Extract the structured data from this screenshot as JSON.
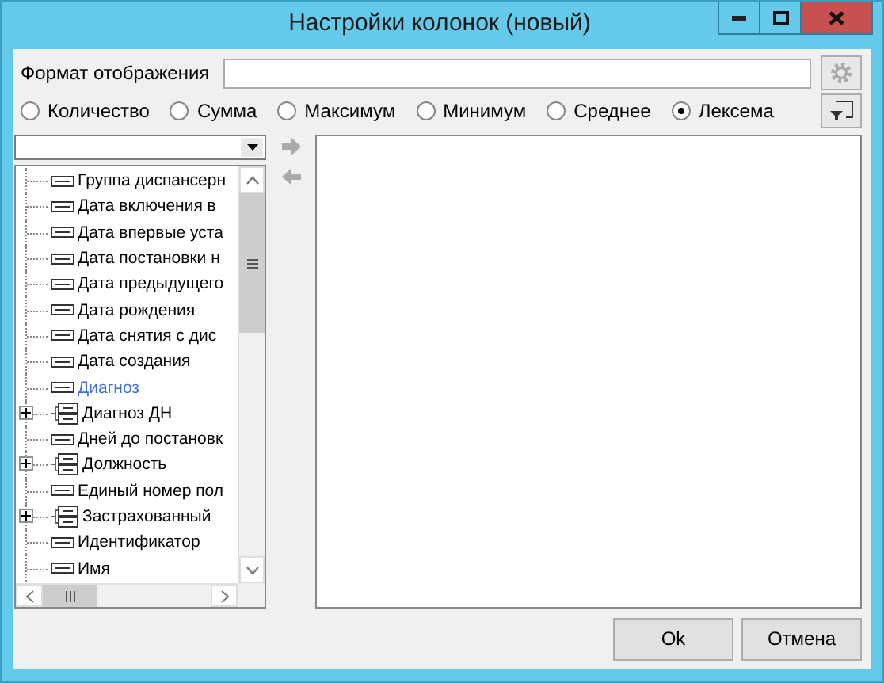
{
  "window": {
    "title": "Настройки колонок (новый)"
  },
  "format": {
    "label": "Формат отображения"
  },
  "aggregates": [
    {
      "label": "Количество",
      "selected": false
    },
    {
      "label": "Сумма",
      "selected": false
    },
    {
      "label": "Максимум",
      "selected": false
    },
    {
      "label": "Минимум",
      "selected": false
    },
    {
      "label": "Среднее",
      "selected": false
    },
    {
      "label": "Лексема",
      "selected": true
    }
  ],
  "fields": [
    {
      "label": "Группа диспансерн",
      "kind": "leaf",
      "selected": false
    },
    {
      "label": "Дата включения в",
      "kind": "leaf",
      "selected": false
    },
    {
      "label": "Дата впервые уста",
      "kind": "leaf",
      "selected": false
    },
    {
      "label": "Дата постановки н",
      "kind": "leaf",
      "selected": false
    },
    {
      "label": "Дата предыдущего",
      "kind": "leaf",
      "selected": false
    },
    {
      "label": "Дата рождения",
      "kind": "leaf",
      "selected": false
    },
    {
      "label": "Дата снятия с дис",
      "kind": "leaf",
      "selected": false
    },
    {
      "label": "Дата создания",
      "kind": "leaf",
      "selected": false
    },
    {
      "label": "Диагноз",
      "kind": "leaf",
      "selected": true
    },
    {
      "label": "Диагноз ДН",
      "kind": "group",
      "selected": false
    },
    {
      "label": "Дней до постановк",
      "kind": "leaf",
      "selected": false
    },
    {
      "label": "Должность",
      "kind": "group",
      "selected": false
    },
    {
      "label": "Единый номер пол",
      "kind": "leaf",
      "selected": false
    },
    {
      "label": "Застрахованный",
      "kind": "group",
      "selected": false
    },
    {
      "label": "Идентификатор",
      "kind": "leaf",
      "selected": false
    },
    {
      "label": "Имя",
      "kind": "leaf",
      "selected": false
    }
  ],
  "buttons": [
    "Ok",
    "Отмена"
  ]
}
